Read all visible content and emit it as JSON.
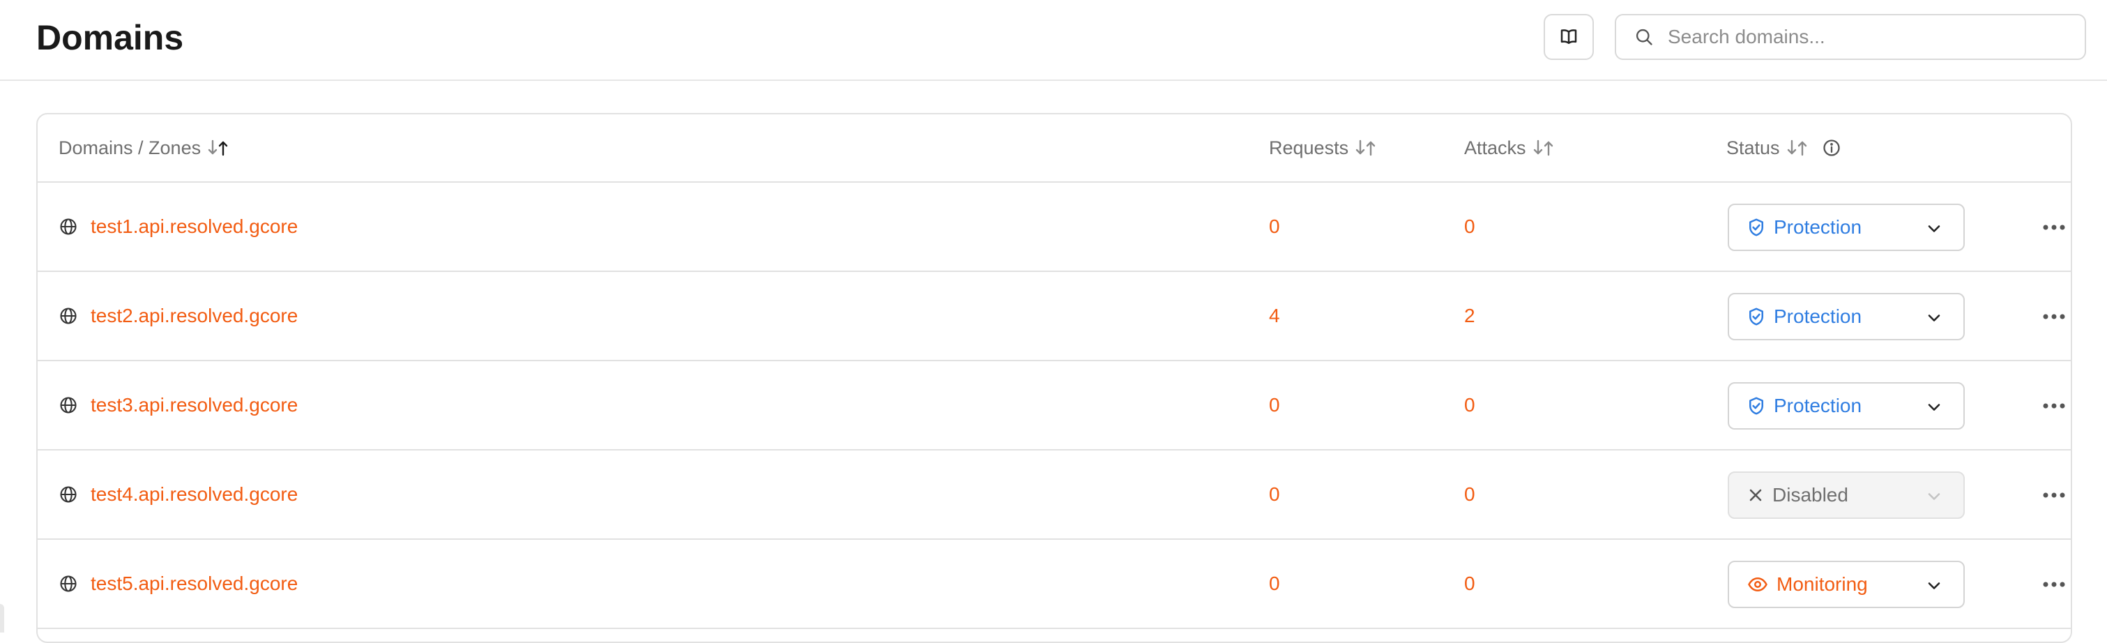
{
  "header": {
    "title": "Domains",
    "docs_icon": "book-icon",
    "search": {
      "placeholder": "Search domains...",
      "value": "",
      "icon": "search-icon"
    }
  },
  "table": {
    "columns": {
      "domains": "Domains / Zones",
      "requests": "Requests",
      "attacks": "Attacks",
      "status": "Status"
    },
    "rows": [
      {
        "domain": "test1.api.resolved.gcore",
        "requests": "0",
        "attacks": "0",
        "status": "Protection"
      },
      {
        "domain": "test2.api.resolved.gcore",
        "requests": "4",
        "attacks": "2",
        "status": "Protection"
      },
      {
        "domain": "test3.api.resolved.gcore",
        "requests": "0",
        "attacks": "0",
        "status": "Protection"
      },
      {
        "domain": "test4.api.resolved.gcore",
        "requests": "0",
        "attacks": "0",
        "status": "Disabled"
      },
      {
        "domain": "test5.api.resolved.gcore",
        "requests": "0",
        "attacks": "0",
        "status": "Monitoring"
      }
    ]
  },
  "colors": {
    "accent": "#f25c12",
    "protection": "#2f7de1",
    "disabled": "#6f6f6f",
    "monitoring": "#f25c12"
  }
}
